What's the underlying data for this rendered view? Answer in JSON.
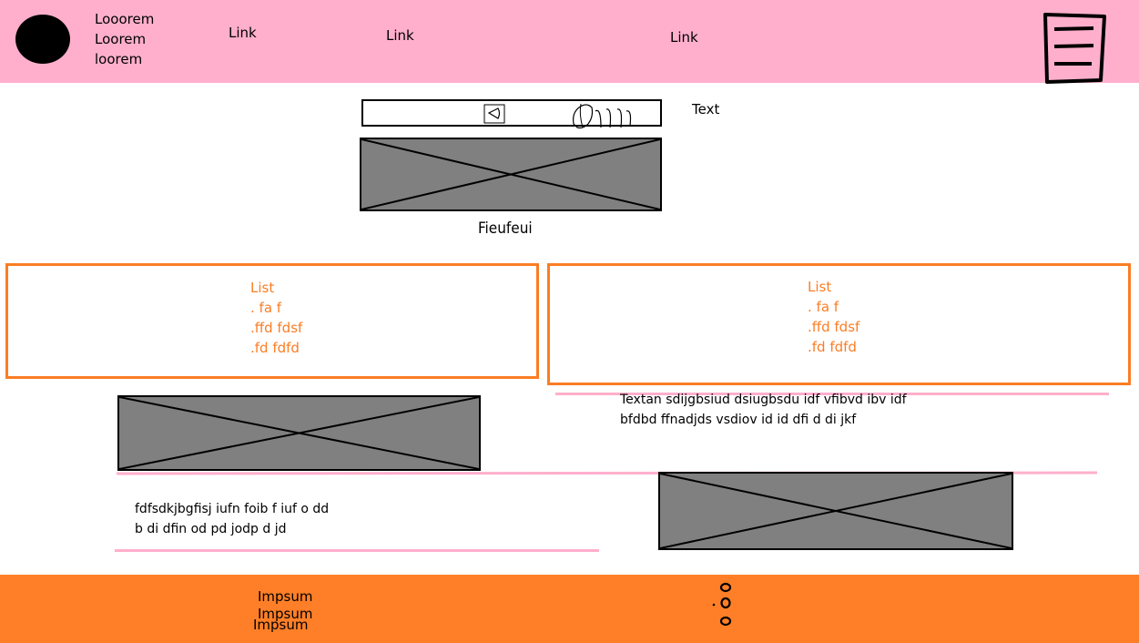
{
  "header": {
    "brand_lines": [
      "Looorem",
      "Loorem",
      "loorem"
    ],
    "links": [
      "Link",
      "Link",
      "Link"
    ]
  },
  "search": {
    "side_text": "Text"
  },
  "hero": {
    "caption": "Fieufeui"
  },
  "lists": [
    {
      "title": "List",
      "items": [
        ". fa f",
        ".ffd fdsf",
        ".fd fdfd"
      ]
    },
    {
      "title": "List",
      "items": [
        ". fa f",
        ".ffd fdsf",
        ".fd fdfd"
      ]
    }
  ],
  "right_text": {
    "lines": [
      "Textan sdijgbsiud dsiugbsdu idf vfibvd ibv idf",
      "bfdbd ffnadjds vsdiov id id dfi d di jkf"
    ]
  },
  "left_text": {
    "lines": [
      "fdfsdkjbgfisj iufn foib  f iuf o dd",
      "b di dfin od pd jodp d jd"
    ]
  },
  "footer": {
    "items": [
      "Impsum",
      "Impsum",
      "Impsum"
    ]
  },
  "colors": {
    "header_bg": "#ffafcc",
    "accent_orange": "#fb7d24",
    "footer_bg": "#fe7f27",
    "placeholder_gray": "#808080"
  },
  "icons": [
    "logo-circle",
    "menu-icon",
    "search-icon",
    "hand-icon",
    "image-placeholder-icon",
    "vertical-dots-icon"
  ]
}
